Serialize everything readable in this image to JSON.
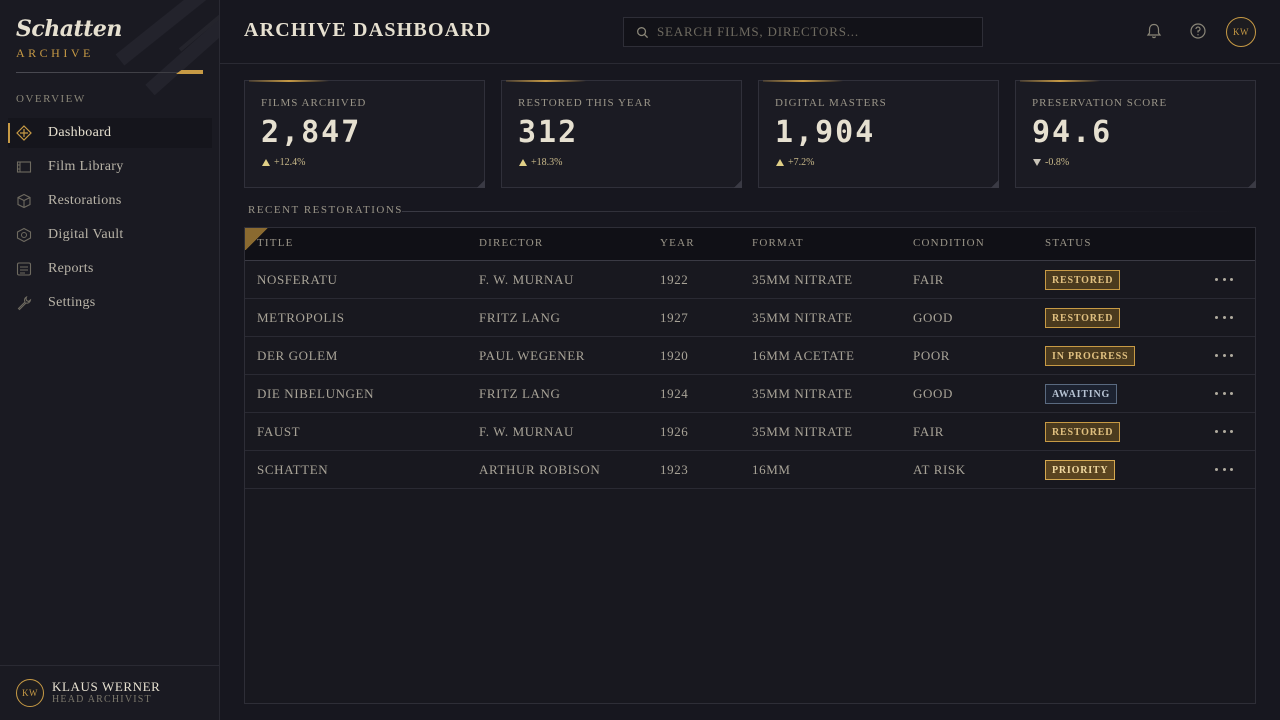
{
  "brand": {
    "name": "Schatten",
    "subtitle": "ARCHIVE"
  },
  "sidebar": {
    "section_label": "OVERVIEW",
    "items": [
      {
        "label": "Dashboard",
        "icon": "compass-icon",
        "active": true
      },
      {
        "label": "Film Library",
        "icon": "film-icon",
        "active": false
      },
      {
        "label": "Restorations",
        "icon": "cube-icon",
        "active": false
      },
      {
        "label": "Digital Vault",
        "icon": "vault-icon",
        "active": false
      },
      {
        "label": "Reports",
        "icon": "report-icon",
        "active": false
      },
      {
        "label": "Settings",
        "icon": "wrench-icon",
        "active": false
      }
    ],
    "user": {
      "initials": "KW",
      "name": "KLAUS WERNER",
      "role": "HEAD ARCHIVIST"
    }
  },
  "header": {
    "title": "ARCHIVE DASHBOARD",
    "search_placeholder": "SEARCH FILMS, DIRECTORS...",
    "avatar_initials": "KW"
  },
  "stats": [
    {
      "label": "FILMS ARCHIVED",
      "value": "2,847",
      "delta": "+12.4%",
      "direction": "up"
    },
    {
      "label": "RESTORED THIS YEAR",
      "value": "312",
      "delta": "+18.3%",
      "direction": "up"
    },
    {
      "label": "DIGITAL MASTERS",
      "value": "1,904",
      "delta": "+7.2%",
      "direction": "up"
    },
    {
      "label": "PRESERVATION SCORE",
      "value": "94.6",
      "delta": "-0.8%",
      "direction": "down"
    }
  ],
  "restorations": {
    "title": "RECENT RESTORATIONS",
    "columns": [
      "TITLE",
      "DIRECTOR",
      "YEAR",
      "FORMAT",
      "CONDITION",
      "STATUS"
    ],
    "rows": [
      {
        "title": "NOSFERATU",
        "director": "F. W. MURNAU",
        "year": "1922",
        "format": "35MM NITRATE",
        "condition": "FAIR",
        "status": "RESTORED",
        "status_style": "gold"
      },
      {
        "title": "METROPOLIS",
        "director": "FRITZ LANG",
        "year": "1927",
        "format": "35MM NITRATE",
        "condition": "GOOD",
        "status": "RESTORED",
        "status_style": "gold"
      },
      {
        "title": "DER GOLEM",
        "director": "PAUL WEGENER",
        "year": "1920",
        "format": "16MM ACETATE",
        "condition": "POOR",
        "status": "IN PROGRESS",
        "status_style": "gold"
      },
      {
        "title": "DIE NIBELUNGEN",
        "director": "FRITZ LANG",
        "year": "1924",
        "format": "35MM NITRATE",
        "condition": "GOOD",
        "status": "AWAITING",
        "status_style": "slate"
      },
      {
        "title": "FAUST",
        "director": "F. W. MURNAU",
        "year": "1926",
        "format": "35MM NITRATE",
        "condition": "FAIR",
        "status": "RESTORED",
        "status_style": "gold"
      },
      {
        "title": "SCHATTEN",
        "director": "ARTHUR ROBISON",
        "year": "1923",
        "format": "16MM",
        "condition": "AT RISK",
        "status": "PRIORITY",
        "status_style": "priority"
      }
    ]
  },
  "colors": {
    "accent": "#c79a45",
    "background": "#17171f",
    "panel": "#1b1b23",
    "text": "#c9c4b8"
  }
}
